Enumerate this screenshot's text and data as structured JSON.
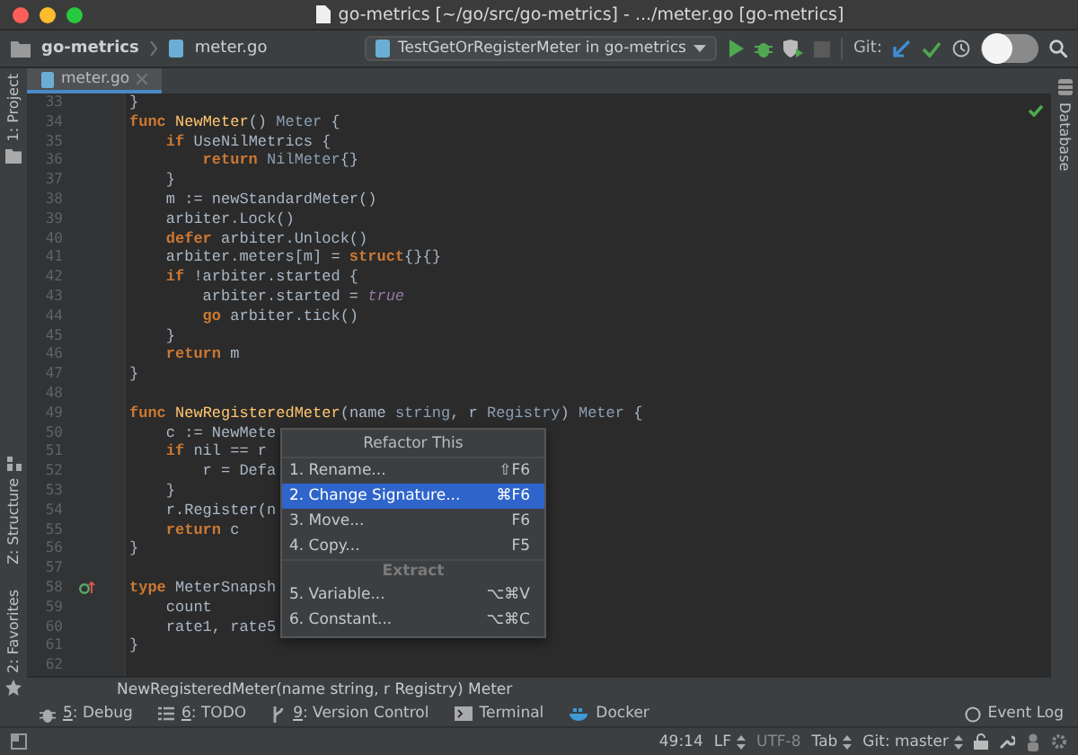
{
  "window": {
    "title": "go-metrics [~/go/src/go-metrics] - .../meter.go [go-metrics]"
  },
  "navbar": {
    "breadcrumbs": [
      "go-metrics",
      "meter.go"
    ],
    "run_config": "TestGetOrRegisterMeter in go-metrics",
    "git_label": "Git:"
  },
  "tabs": [
    {
      "label": "meter.go",
      "selected": true
    }
  ],
  "left_tool_windows": [
    {
      "label": "1: Project"
    },
    {
      "label": "Z: Structure"
    },
    {
      "label": "2: Favorites"
    }
  ],
  "right_tool_windows": [
    {
      "label": "Database"
    }
  ],
  "editor": {
    "lines": [
      {
        "number": "33",
        "tokens": [
          {
            "kind": "plain",
            "text": "}"
          }
        ]
      },
      {
        "number": "34",
        "tokens": [
          {
            "kind": "kw",
            "text": "func "
          },
          {
            "kind": "fn",
            "text": "NewMeter"
          },
          {
            "kind": "plain",
            "text": "() "
          },
          {
            "kind": "type",
            "text": "Meter"
          },
          {
            "kind": "plain",
            "text": " {"
          }
        ]
      },
      {
        "number": "35",
        "tokens": [
          {
            "kind": "kw",
            "text": "    if"
          },
          {
            "kind": "plain",
            "text": " UseNilMetrics {"
          }
        ]
      },
      {
        "number": "36",
        "tokens": [
          {
            "kind": "kw",
            "text": "        return "
          },
          {
            "kind": "type",
            "text": "NilMeter"
          },
          {
            "kind": "plain",
            "text": "{}"
          }
        ]
      },
      {
        "number": "37",
        "tokens": [
          {
            "kind": "plain",
            "text": "    }"
          }
        ]
      },
      {
        "number": "38",
        "tokens": [
          {
            "kind": "plain",
            "text": "    m := newStandardMeter()"
          }
        ]
      },
      {
        "number": "39",
        "tokens": [
          {
            "kind": "plain",
            "text": "    arbiter.Lock()"
          }
        ]
      },
      {
        "number": "40",
        "tokens": [
          {
            "kind": "kw",
            "text": "    defer"
          },
          {
            "kind": "plain",
            "text": " arbiter.Unlock()"
          }
        ]
      },
      {
        "number": "41",
        "tokens": [
          {
            "kind": "plain",
            "text": "    arbiter.meters[m] = "
          },
          {
            "kind": "kw",
            "text": "struct"
          },
          {
            "kind": "plain",
            "text": "{}{}"
          }
        ]
      },
      {
        "number": "42",
        "tokens": [
          {
            "kind": "kw",
            "text": "    if"
          },
          {
            "kind": "plain",
            "text": " !arbiter.started {"
          }
        ]
      },
      {
        "number": "43",
        "tokens": [
          {
            "kind": "plain",
            "text": "        arbiter.started = "
          },
          {
            "kind": "const",
            "text": "true"
          }
        ]
      },
      {
        "number": "44",
        "tokens": [
          {
            "kind": "kw",
            "text": "        go"
          },
          {
            "kind": "plain",
            "text": " arbiter.tick()"
          }
        ]
      },
      {
        "number": "45",
        "tokens": [
          {
            "kind": "plain",
            "text": "    }"
          }
        ]
      },
      {
        "number": "46",
        "tokens": [
          {
            "kind": "kw",
            "text": "    return"
          },
          {
            "kind": "plain",
            "text": " m"
          }
        ]
      },
      {
        "number": "47",
        "tokens": [
          {
            "kind": "plain",
            "text": "}"
          }
        ]
      },
      {
        "number": "48"
      },
      {
        "number": "49",
        "tokens": [
          {
            "kind": "kw",
            "text": "func "
          },
          {
            "kind": "fn",
            "text": "NewRegisteredMeter"
          },
          {
            "kind": "plain",
            "text": "(name "
          },
          {
            "kind": "type",
            "text": "string"
          },
          {
            "kind": "plain",
            "text": ", r "
          },
          {
            "kind": "type",
            "text": "Registry"
          },
          {
            "kind": "plain",
            "text": ") "
          },
          {
            "kind": "type",
            "text": "Meter"
          },
          {
            "kind": "plain",
            "text": " {"
          }
        ]
      },
      {
        "number": "50",
        "tokens": [
          {
            "kind": "plain",
            "text": "    c := NewMete"
          }
        ]
      },
      {
        "number": "51",
        "tokens": [
          {
            "kind": "kw",
            "text": "    if"
          },
          {
            "kind": "plain",
            "text": " nil == r"
          }
        ]
      },
      {
        "number": "52",
        "tokens": [
          {
            "kind": "plain",
            "text": "        r = Defa"
          }
        ]
      },
      {
        "number": "53",
        "tokens": [
          {
            "kind": "plain",
            "text": "    }"
          }
        ]
      },
      {
        "number": "54",
        "tokens": [
          {
            "kind": "plain",
            "text": "    r.Register(n"
          }
        ]
      },
      {
        "number": "55",
        "tokens": [
          {
            "kind": "kw",
            "text": "    return"
          },
          {
            "kind": "plain",
            "text": " c"
          }
        ]
      },
      {
        "number": "56",
        "tokens": [
          {
            "kind": "plain",
            "text": "}"
          }
        ]
      },
      {
        "number": "57"
      },
      {
        "number": "58",
        "implemented": true,
        "tokens": [
          {
            "kind": "kw",
            "text": "type"
          },
          {
            "kind": "plain",
            "text": " MeterSnapsh"
          }
        ]
      },
      {
        "number": "59",
        "tokens": [
          {
            "kind": "plain",
            "text": "    count"
          }
        ]
      },
      {
        "number": "60",
        "tokens": [
          {
            "kind": "plain",
            "text": "    rate1, rate5"
          }
        ]
      },
      {
        "number": "61",
        "tokens": [
          {
            "kind": "plain",
            "text": "}"
          }
        ]
      },
      {
        "number": "62"
      }
    ]
  },
  "refactor_popup": {
    "title": "Refactor This",
    "items": [
      {
        "kind": "action",
        "label": "1. Rename...",
        "shortcut": "⇧F6",
        "selected": false
      },
      {
        "kind": "action",
        "label": "2. Change Signature...",
        "shortcut": "⌘F6",
        "selected": true
      },
      {
        "kind": "action",
        "label": "3. Move...",
        "shortcut": "F6",
        "selected": false
      },
      {
        "kind": "action",
        "label": "4. Copy...",
        "shortcut": "F5",
        "selected": false
      },
      {
        "kind": "header",
        "label": "Extract"
      },
      {
        "kind": "action",
        "label": "5. Variable...",
        "shortcut": "⌥⌘V",
        "selected": false
      },
      {
        "kind": "action",
        "label": "6. Constant...",
        "shortcut": "⌥⌘C",
        "selected": false
      }
    ]
  },
  "hint": "NewRegisteredMeter(name string, r Registry) Meter",
  "bottom_tools": [
    {
      "mnemonic": "5",
      "label": ": Debug"
    },
    {
      "mnemonic": "6",
      "label": ": TODO"
    },
    {
      "mnemonic": "9",
      "label": ": Version Control"
    },
    {
      "label": "Terminal"
    },
    {
      "label": "Docker"
    }
  ],
  "event_log": "Event Log",
  "status_bar": {
    "position": "49:14",
    "line_separator": "LF",
    "encoding": "UTF-8",
    "indent": "Tab",
    "vcs_branch": "Git: master"
  }
}
